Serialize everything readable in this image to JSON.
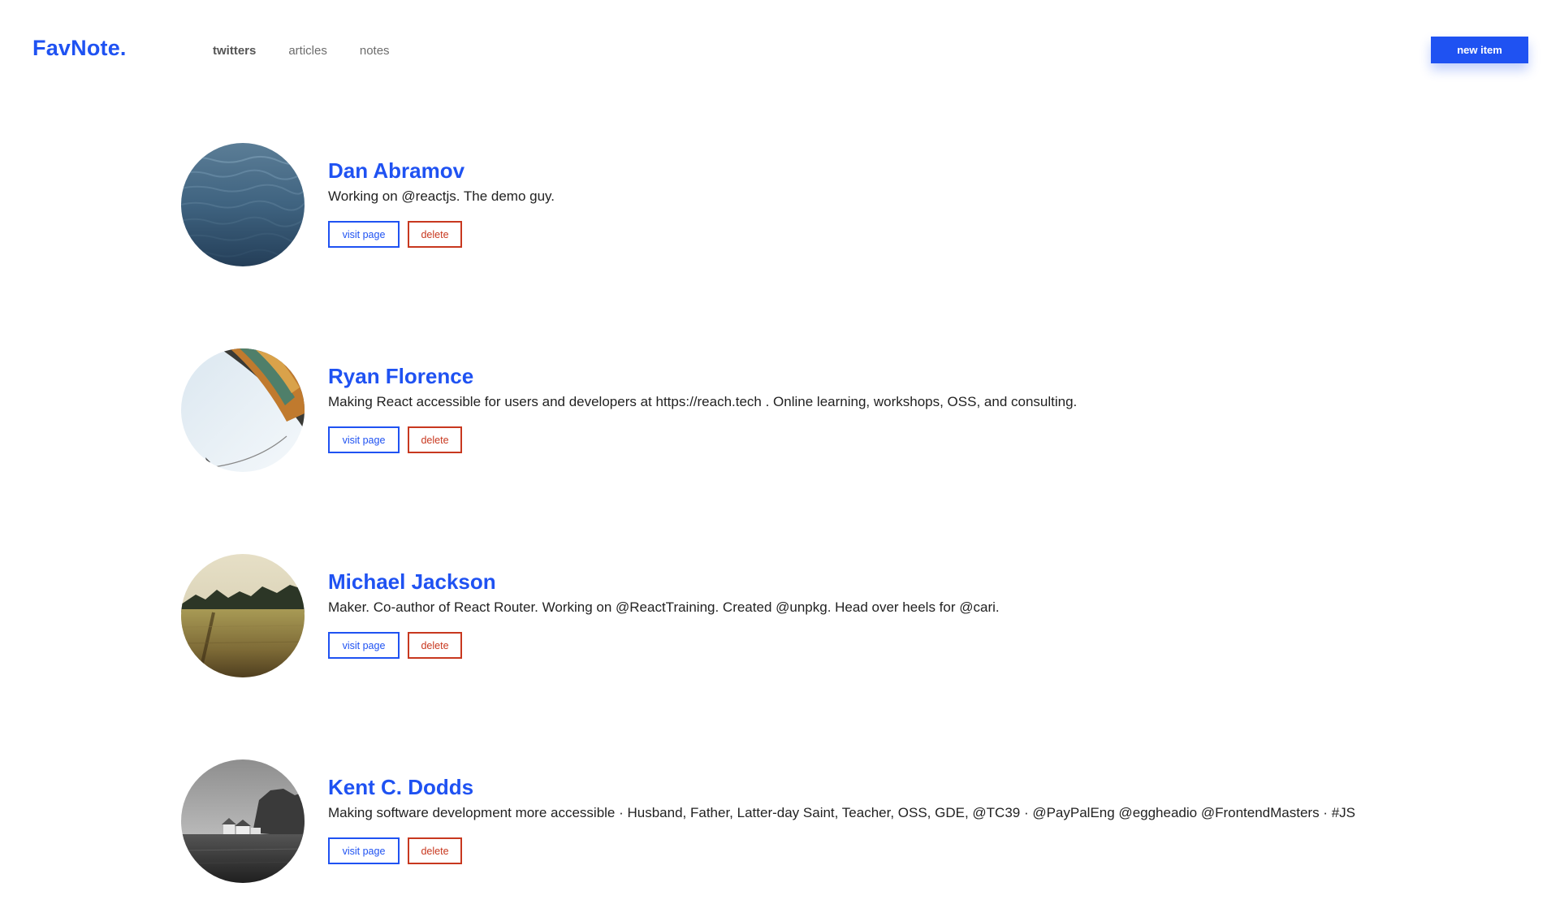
{
  "header": {
    "logo": "FavNote.",
    "nav": [
      {
        "label": "twitters",
        "active": true
      },
      {
        "label": "articles",
        "active": false
      },
      {
        "label": "notes",
        "active": false
      }
    ],
    "new_item_label": "new item"
  },
  "colors": {
    "accent": "#1f52f2",
    "danger": "#c8381f"
  },
  "items": [
    {
      "name": "Dan Abramov",
      "bio": "Working on @reactjs. The demo guy.",
      "visit_label": "visit page",
      "delete_label": "delete",
      "avatar": "ocean-water-photo"
    },
    {
      "name": "Ryan Florence",
      "bio": "Making React accessible for users and developers at https://reach.tech . Online learning, workshops, OSS, and consulting.",
      "visit_label": "visit page",
      "delete_label": "delete",
      "avatar": "hot-air-balloon-photo"
    },
    {
      "name": "Michael Jackson",
      "bio": "Maker. Co-author of React Router. Working on @ReactTraining. Created @unpkg. Head over heels for @cari.",
      "visit_label": "visit page",
      "delete_label": "delete",
      "avatar": "meadow-field-photo"
    },
    {
      "name": "Kent C. Dodds",
      "bio": "Making software development more accessible · Husband, Father, Latter-day Saint, Teacher, OSS, GDE, @TC39 · @PayPalEng @eggheadio @FrontendMasters · #JS",
      "visit_label": "visit page",
      "delete_label": "delete",
      "avatar": "coastal-houses-photo"
    }
  ]
}
